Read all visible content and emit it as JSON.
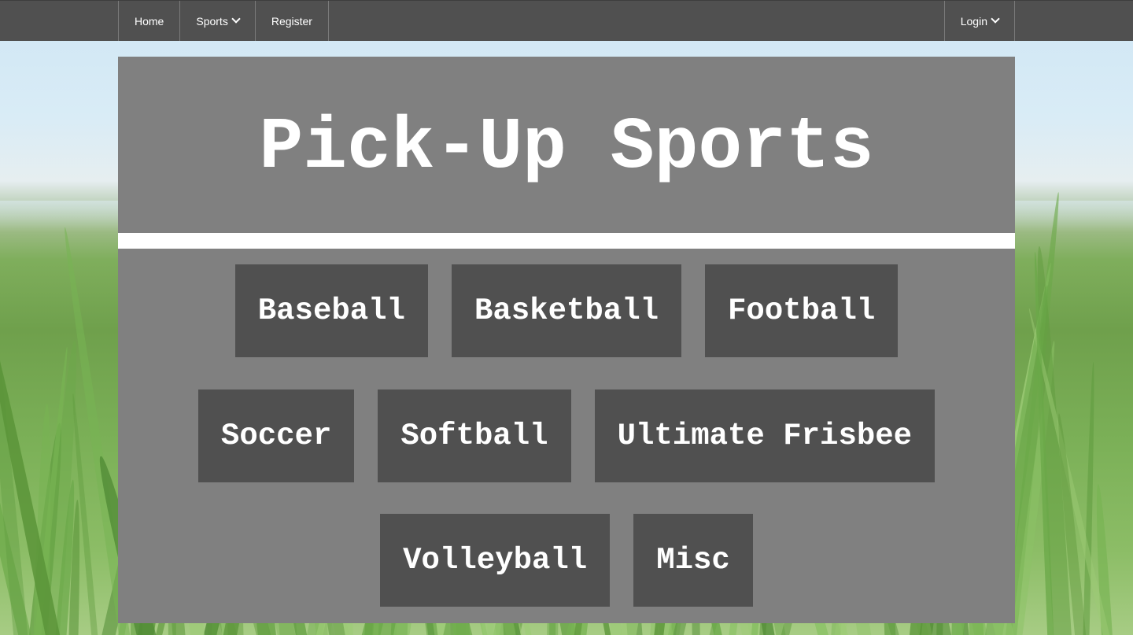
{
  "page": {
    "title": "Pick-Up Sports"
  },
  "nav": {
    "home_label": "Home",
    "sports_label": "Sports",
    "register_label": "Register",
    "login_label": "Login",
    "dropdown_icon": "chevron-down-icon"
  },
  "sports": {
    "row1": [
      "Baseball",
      "Basketball",
      "Football"
    ],
    "row2": [
      "Soccer",
      "Softball",
      "Ultimate Frisbee"
    ],
    "row3": [
      "Volleyball",
      "Misc"
    ]
  },
  "colors": {
    "navbar": "#505050",
    "panel": "#808080",
    "button": "#505050",
    "text": "#ffffff",
    "divider": "#ffffff"
  }
}
